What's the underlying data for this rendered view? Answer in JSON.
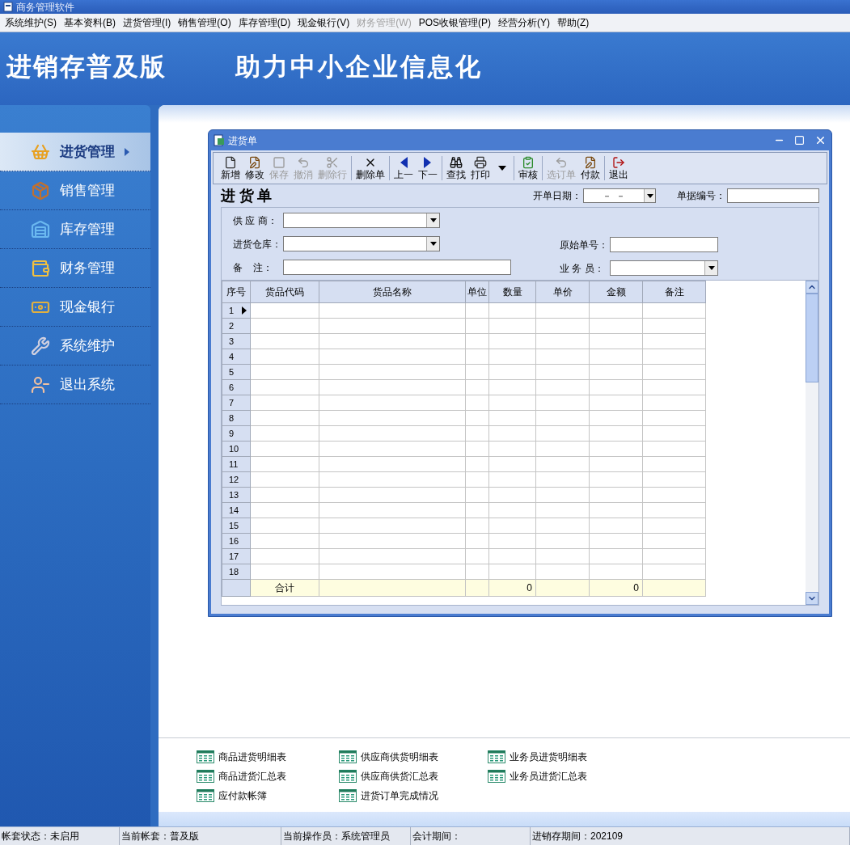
{
  "window": {
    "title": "商务管理软件"
  },
  "menu": [
    {
      "label": "系统维护(S)",
      "disabled": false
    },
    {
      "label": "基本资料(B)",
      "disabled": false
    },
    {
      "label": "进货管理(I)",
      "disabled": false
    },
    {
      "label": "销售管理(O)",
      "disabled": false
    },
    {
      "label": "库存管理(D)",
      "disabled": false
    },
    {
      "label": "现金银行(V)",
      "disabled": false
    },
    {
      "label": "财务管理(W)",
      "disabled": true
    },
    {
      "label": "POS收银管理(P)",
      "disabled": false
    },
    {
      "label": "经营分析(Y)",
      "disabled": false
    },
    {
      "label": "帮助(Z)",
      "disabled": false
    }
  ],
  "header": {
    "product": "进销存普及版",
    "slogan": "助力中小企业信息化"
  },
  "sidebar": {
    "items": [
      {
        "label": "进货管理",
        "selected": true
      },
      {
        "label": "销售管理",
        "selected": false
      },
      {
        "label": "库存管理",
        "selected": false
      },
      {
        "label": "财务管理",
        "selected": false
      },
      {
        "label": "现金银行",
        "selected": false
      },
      {
        "label": "系统维护",
        "selected": false
      },
      {
        "label": "退出系统",
        "selected": false
      }
    ]
  },
  "document": {
    "title": "进货单",
    "heading": "进 货 单",
    "toolbar": [
      [
        {
          "label": "新增",
          "disabled": false
        },
        {
          "label": "修改",
          "disabled": false
        },
        {
          "label": "保存",
          "disabled": true
        },
        {
          "label": "撤消",
          "disabled": true
        },
        {
          "label": "删除行",
          "disabled": true
        }
      ],
      [
        {
          "label": "删除单",
          "disabled": false
        }
      ],
      [
        {
          "label": "上一",
          "disabled": false
        },
        {
          "label": "下一",
          "disabled": false
        }
      ],
      [
        {
          "label": "查找",
          "disabled": false
        },
        {
          "label": "打印",
          "disabled": false,
          "has_menu": true
        }
      ],
      [
        {
          "label": "审核",
          "disabled": false
        }
      ],
      [
        {
          "label": "选订单",
          "disabled": true
        },
        {
          "label": "付款",
          "disabled": false
        }
      ],
      [
        {
          "label": "退出",
          "disabled": false
        }
      ]
    ],
    "date": {
      "label": "开单日期：",
      "value": "－  －"
    },
    "number": {
      "label": "单据编号："
    },
    "fields": [
      {
        "label": "供 应 商：",
        "dropdown": true
      },
      {
        "label": "进货仓库：",
        "dropdown": true
      },
      {
        "label": "备    注：",
        "dropdown": false
      }
    ],
    "side_fields": [
      {
        "label": "原始单号：",
        "dropdown": false
      },
      {
        "label": "业 务 员：",
        "dropdown": true
      }
    ],
    "table": {
      "columns": [
        "序号",
        "货品代码",
        "货品名称",
        "单位",
        "数量",
        "单价",
        "金额",
        "备注"
      ],
      "rows": [
        {
          "no": "1",
          "current": true
        },
        {
          "no": "2",
          "current": false
        },
        {
          "no": "3",
          "current": false
        },
        {
          "no": "4",
          "current": false
        },
        {
          "no": "5",
          "current": false
        },
        {
          "no": "6",
          "current": false
        },
        {
          "no": "7",
          "current": false
        },
        {
          "no": "8",
          "current": false
        },
        {
          "no": "9",
          "current": false
        },
        {
          "no": "10",
          "current": false
        },
        {
          "no": "11",
          "current": false
        },
        {
          "no": "12",
          "current": false
        },
        {
          "no": "13",
          "current": false
        },
        {
          "no": "14",
          "current": false
        },
        {
          "no": "15",
          "current": false
        },
        {
          "no": "16",
          "current": false
        },
        {
          "no": "17",
          "current": false
        },
        {
          "no": "18",
          "current": false
        }
      ],
      "totals": {
        "label": "合计",
        "quantity": "0",
        "amount": "0"
      }
    }
  },
  "reports": [
    [
      "商品进货明细表",
      "商品进货汇总表",
      "应付款帐簿"
    ],
    [
      "供应商供货明细表",
      "供应商供货汇总表",
      "进货订单完成情况"
    ],
    [
      "业务员进货明细表",
      "业务员进货汇总表"
    ]
  ],
  "status_bar": [
    "帐套状态：未启用",
    "当前帐套：普及版",
    "当前操作员：系统管理员",
    "会计期间：",
    "进销存期间：202109"
  ]
}
